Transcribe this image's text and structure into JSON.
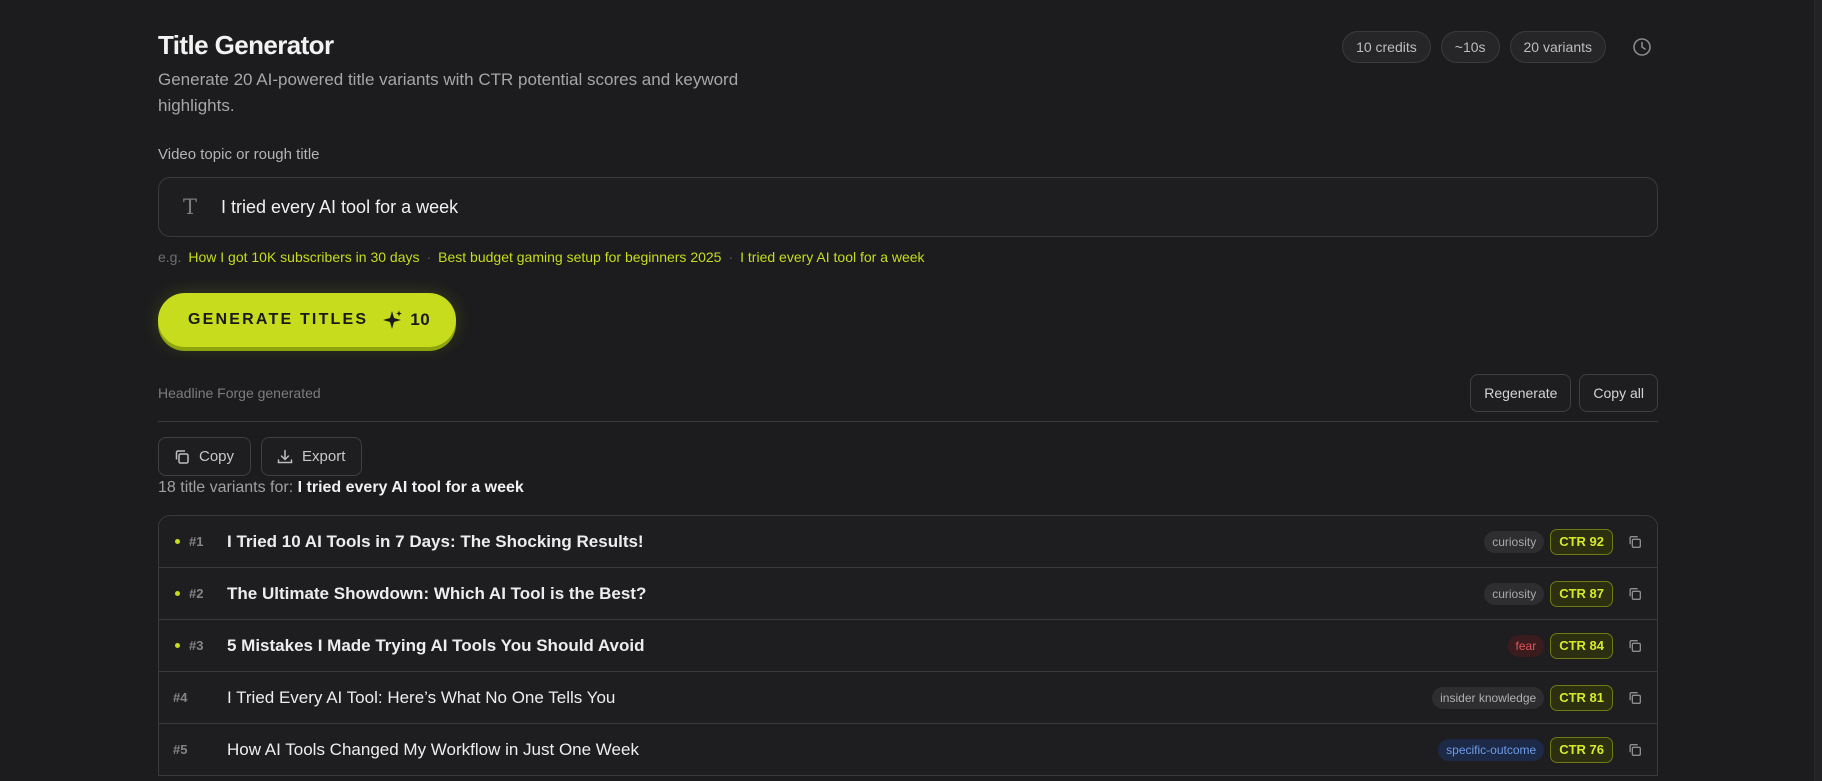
{
  "header": {
    "title": "Title Generator",
    "subtitle": "Generate 20 AI-powered title variants with CTR potential scores and keyword highlights.",
    "chips": [
      "10 credits",
      "~10s",
      "20 variants"
    ]
  },
  "form": {
    "label": "Video topic or rough title",
    "input_icon": "T",
    "input_value": "I tried every AI tool for a week",
    "examples_prefix": "e.g.",
    "examples": [
      "How I got 10K subscribers in 30 days",
      "Best budget gaming setup for beginners 2025",
      "I tried every AI tool for a week"
    ],
    "separator": "·",
    "generate_label": "GENERATE TITLES",
    "generate_cost": "10"
  },
  "results": {
    "generated_by": "Headline Forge generated",
    "regenerate_label": "Regenerate",
    "copy_all_label": "Copy all",
    "copy_label": "Copy",
    "export_label": "Export",
    "summary_prefix": "18 title variants for:",
    "summary_topic": "I tried every AI tool for a week",
    "rows": [
      {
        "rank": "#1",
        "title": "I Tried 10 AI Tools in 7 Days: The Shocking Results!",
        "tag": "curiosity",
        "ctr": "CTR 92"
      },
      {
        "rank": "#2",
        "title": "The Ultimate Showdown: Which AI Tool is the Best?",
        "tag": "curiosity",
        "ctr": "CTR 87"
      },
      {
        "rank": "#3",
        "title": "5 Mistakes I Made Trying AI Tools You Should Avoid",
        "tag": "fear",
        "ctr": "CTR 84"
      },
      {
        "rank": "#4",
        "title": "I Tried Every AI Tool: Here’s What No One Tells You",
        "tag": "insider knowledge",
        "ctr": "CTR 81"
      },
      {
        "rank": "#5",
        "title": "How AI Tools Changed My Workflow in Just One Week",
        "tag": "specific-outcome",
        "ctr": "CTR 76"
      }
    ]
  },
  "colors": {
    "accent": "#c6dc1c",
    "background": "#1c1c1e",
    "fear_tag": "#e0555a",
    "specific_tag": "#6d9be8"
  },
  "icons": {
    "history": "clock-icon",
    "input": "text-type-icon",
    "generate": "sparkle-icon",
    "copy": "copy-icon",
    "export": "download-icon"
  }
}
